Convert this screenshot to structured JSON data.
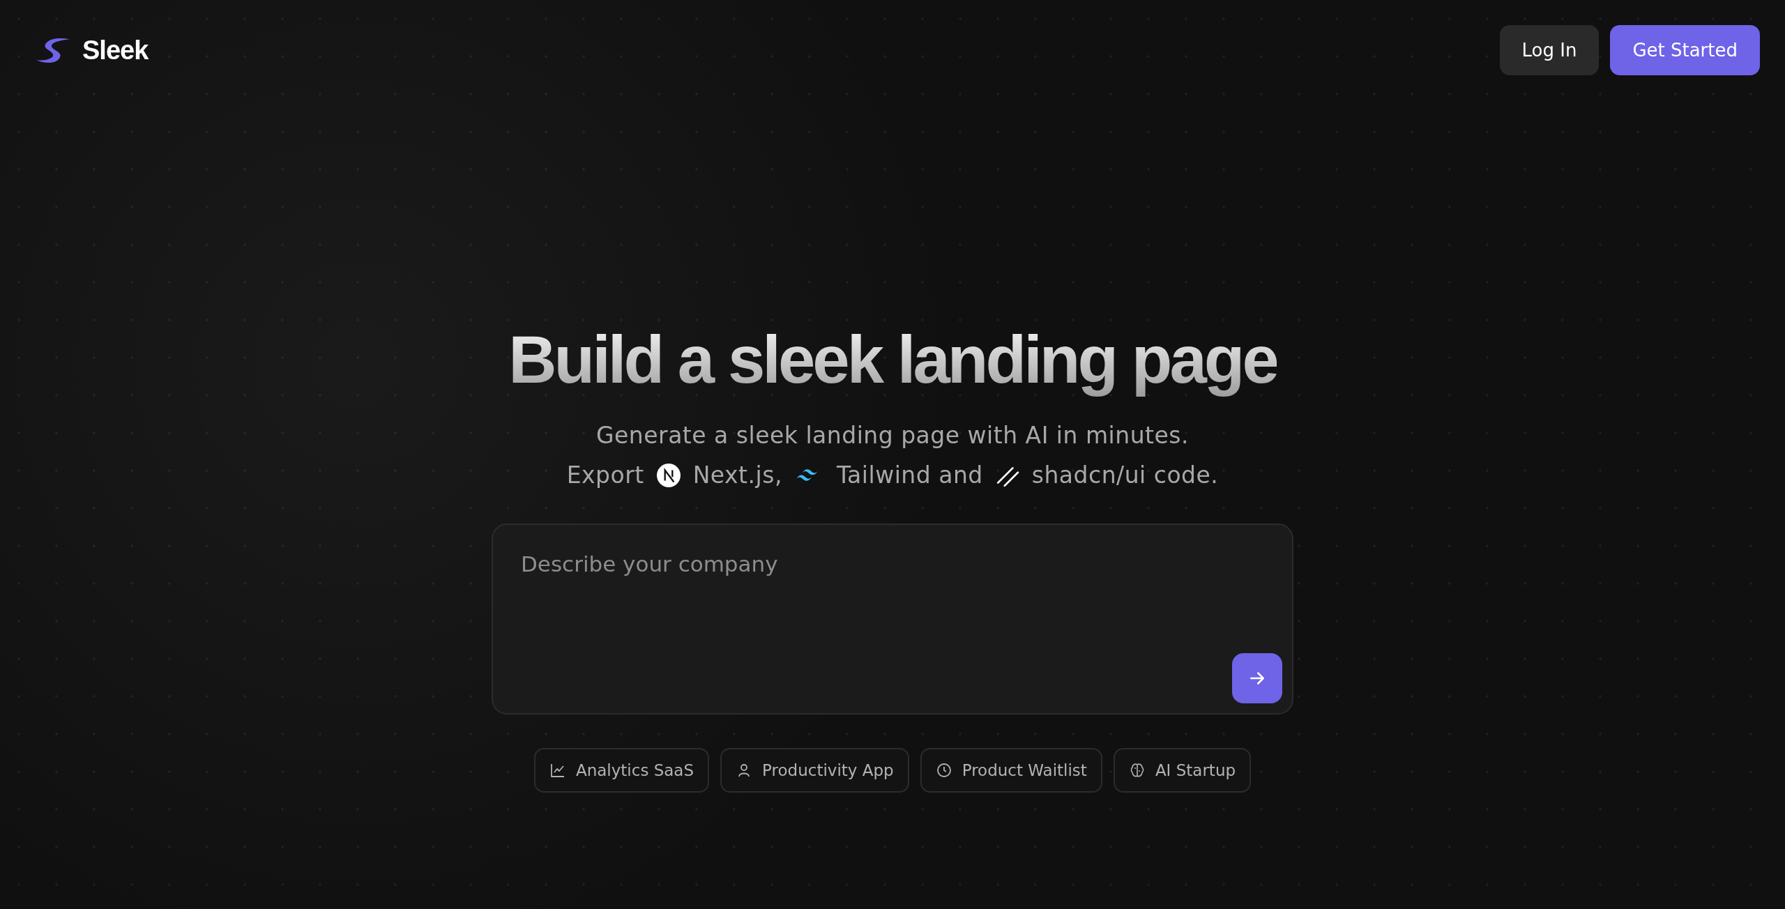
{
  "brand": {
    "name": "Sleek"
  },
  "nav": [
    {
      "label": "Log In",
      "kind": "secondary"
    },
    {
      "label": "Get Started",
      "kind": "primary"
    }
  ],
  "headline": "Build a sleek landing page",
  "subtitle": {
    "line1": "Generate a sleek landing page with AI in minutes.",
    "line2": [
      {
        "kind": "text",
        "text": "Export"
      },
      {
        "kind": "nextjs-icon"
      },
      {
        "kind": "text",
        "text": "Next.js,"
      },
      {
        "kind": "tailwind-icon"
      },
      {
        "kind": "text",
        "text": "Tailwind and"
      },
      {
        "kind": "shadcn-icon"
      },
      {
        "kind": "text",
        "text": "shadcn/ui code."
      }
    ]
  },
  "prompt": {
    "placeholder": "Describe your company"
  },
  "suggestions": [
    {
      "label": "Analytics SaaS",
      "kind": "chart"
    },
    {
      "label": "Productivity App",
      "kind": "person"
    },
    {
      "label": "Product Waitlist",
      "kind": "clock"
    },
    {
      "label": "AI Startup",
      "kind": "brain"
    }
  ]
}
